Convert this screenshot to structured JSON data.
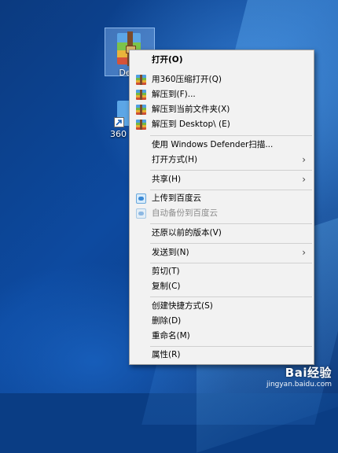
{
  "desktop": {
    "icons": [
      {
        "label": "Desk"
      },
      {
        "label": "360"
      }
    ]
  },
  "menu": {
    "items": [
      {
        "label": "打开(O)",
        "icon": "",
        "bold": true
      },
      {
        "label": "用360压缩打开(Q)",
        "icon": "360zip-icon"
      },
      {
        "label": "解压到(F)...",
        "icon": "360zip-icon"
      },
      {
        "label": "解压到当前文件夹(X)",
        "icon": "360zip-icon"
      },
      {
        "label": "解压到 Desktop\\ (E)",
        "icon": "360zip-icon"
      },
      {
        "label": "使用 Windows Defender扫描...",
        "icon": ""
      },
      {
        "label": "打开方式(H)",
        "icon": "",
        "submenu": true
      },
      {
        "label": "共享(H)",
        "icon": "",
        "submenu": true
      },
      {
        "label": "上传到百度云",
        "icon": "baidu-cloud-icon"
      },
      {
        "label": "自动备份到百度云",
        "icon": "baidu-cloud-icon",
        "disabled": true
      },
      {
        "label": "还原以前的版本(V)",
        "icon": ""
      },
      {
        "label": "发送到(N)",
        "icon": "",
        "submenu": true
      },
      {
        "label": "剪切(T)",
        "icon": ""
      },
      {
        "label": "复制(C)",
        "icon": ""
      },
      {
        "label": "创建快捷方式(S)",
        "icon": ""
      },
      {
        "label": "删除(D)",
        "icon": ""
      },
      {
        "label": "重命名(M)",
        "icon": ""
      },
      {
        "label": "属性(R)",
        "icon": ""
      }
    ],
    "submenu_arrow": "›"
  },
  "watermark": {
    "brand": "Bai经验",
    "url": "jingyan.baidu.com"
  }
}
